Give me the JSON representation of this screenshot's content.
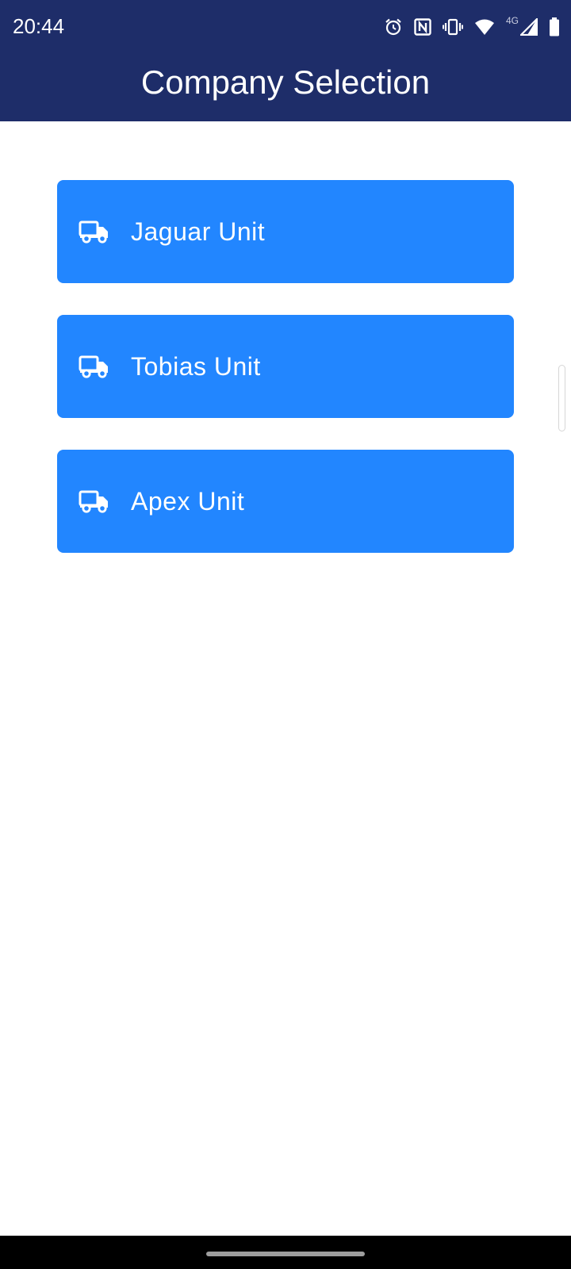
{
  "status_bar": {
    "time": "20:44",
    "network_type": "4G",
    "icons": [
      "alarm-icon",
      "nfc-icon",
      "vibrate-icon",
      "wifi-icon",
      "signal-icon",
      "battery-icon"
    ]
  },
  "app_bar": {
    "title": "Company Selection"
  },
  "companies": [
    {
      "label": "Jaguar Unit",
      "icon": "truck-icon"
    },
    {
      "label": "Tobias Unit",
      "icon": "truck-icon"
    },
    {
      "label": "Apex Unit",
      "icon": "truck-icon"
    }
  ],
  "colors": {
    "header_background": "#1e2d69",
    "button_background": "#2286ff",
    "button_text": "#ffffff",
    "page_background": "#ffffff"
  }
}
